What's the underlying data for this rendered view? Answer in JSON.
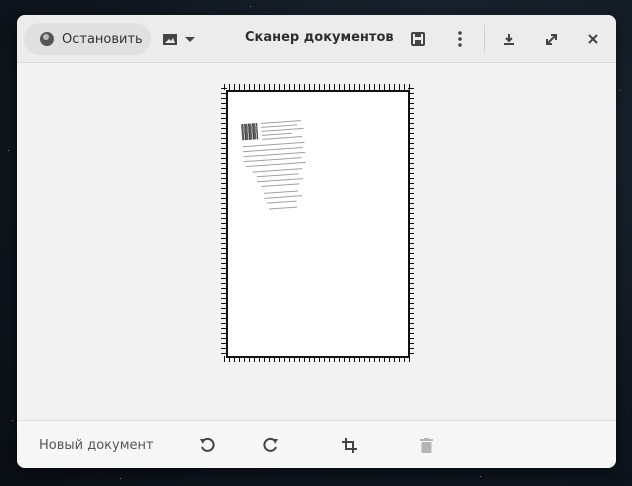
{
  "window": {
    "title": "Сканер документов"
  },
  "header": {
    "stop_label": "Остановить",
    "icons": {
      "stop": "stop-record-icon",
      "image_type": "image-icon",
      "dropdown": "chevron-down-icon",
      "save": "save-icon",
      "menu": "more-vertical-icon",
      "minimize": "minimize-icon",
      "maximize": "maximize-icon",
      "close": "close-icon"
    }
  },
  "bottom": {
    "new_document_label": "Новый документ",
    "icons": {
      "rotate_left": "rotate-left-icon",
      "rotate_right": "rotate-right-icon",
      "crop": "crop-icon",
      "delete": "trash-icon"
    }
  },
  "colors": {
    "window_bg": "#f2f2f2",
    "text_primary": "#2e2e2e",
    "text_secondary": "#555555",
    "icon": "#444444",
    "icon_disabled": "#b5b5b5"
  }
}
